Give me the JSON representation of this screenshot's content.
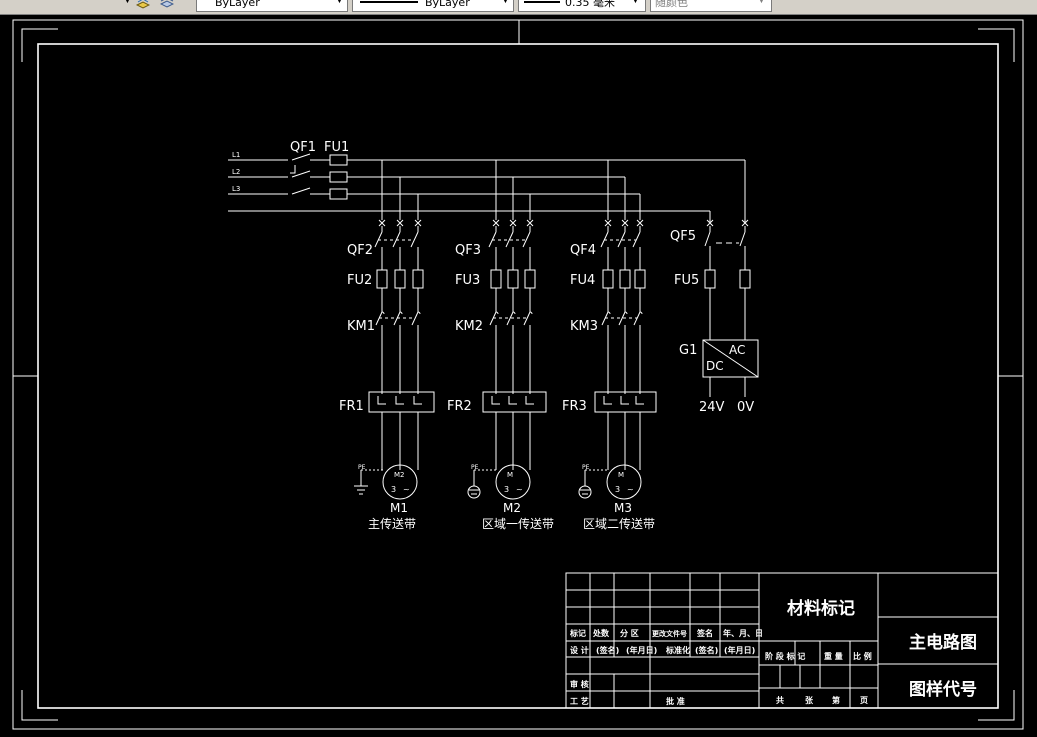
{
  "toolbar": {
    "layer_value": "ByLayer",
    "linetype_value": "ByLayer",
    "lineweight_value": "0.35 毫米",
    "color_value": "随颜色"
  },
  "diagram": {
    "wires": [
      "L1",
      "L2",
      "L3"
    ],
    "main_breaker": "QF1",
    "main_fuse": "FU1",
    "branches": [
      {
        "breaker": "QF2",
        "fuse": "FU2",
        "contactor": "KM1",
        "relay": "FR1",
        "motor_symbol": "M2",
        "motor_phase": "3",
        "motor_tilde": "~",
        "pe": "PE",
        "motor": "M1",
        "desc": "主传送带"
      },
      {
        "breaker": "QF3",
        "fuse": "FU3",
        "contactor": "KM2",
        "relay": "FR2",
        "motor_symbol": "M",
        "motor_phase": "3",
        "motor_tilde": "~",
        "pe": "PE",
        "motor": "M2",
        "desc": "区域一传送带"
      },
      {
        "breaker": "QF4",
        "fuse": "FU4",
        "contactor": "KM3",
        "relay": "FR3",
        "motor_symbol": "M",
        "motor_phase": "3",
        "motor_tilde": "~",
        "pe": "PE",
        "motor": "M3",
        "desc": "区域二传送带"
      }
    ],
    "supply": {
      "breaker": "QF5",
      "fuse": "FU5",
      "unit": "G1",
      "ac": "AC",
      "dc": "DC",
      "out_pos": "24V",
      "out_neg": "0V"
    }
  },
  "title_block": {
    "material": "材料标记",
    "drawing_name": "主电路图",
    "drawing_code": "图样代号",
    "rev_headers": [
      "标记",
      "处数",
      "分 区",
      "更改文件号",
      "签名",
      "年、月、日"
    ],
    "design": "设 计",
    "signature1": "(签名)",
    "date1": "(年月日)",
    "standardize": "标准化",
    "signature2": "(签名)",
    "date2": "(年月日)",
    "stage": "阶 段 标 记",
    "weight": "重 量",
    "scale": "比 例",
    "review": "审 核",
    "process": "工 艺",
    "approve": "批 准",
    "sheets_total": "共",
    "sheets_unit": "张",
    "sheet_no": "第",
    "sheet_page": "页"
  }
}
